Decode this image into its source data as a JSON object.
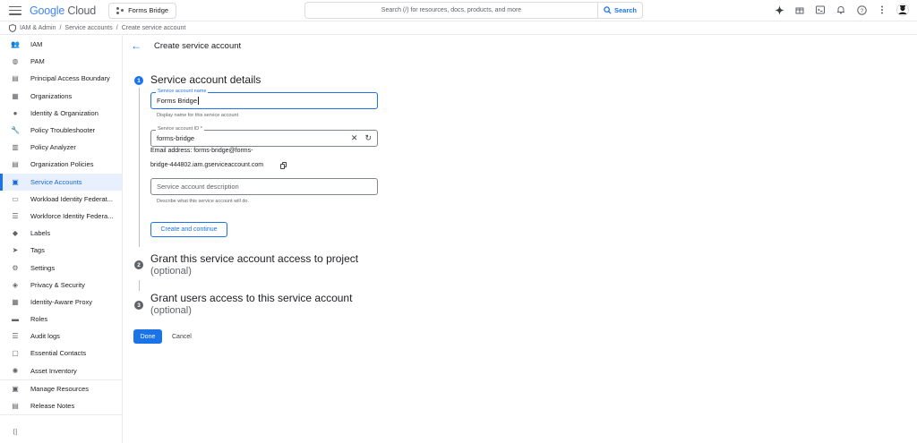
{
  "topbar": {
    "logo": {
      "google": "Google",
      "cloud": "Cloud"
    },
    "project": "Forms Bridge",
    "search_placeholder": "Search (/) for resources, docs, products, and more",
    "search_button": "Search"
  },
  "breadcrumb": [
    "IAM & Admin",
    "Service accounts",
    "Create service account"
  ],
  "sidebar": {
    "items": [
      {
        "label": "IAM",
        "icon": "person-add-icon"
      },
      {
        "label": "PAM",
        "icon": "shield-clock-icon"
      },
      {
        "label": "Principal Access Boundary",
        "icon": "policy-document-icon"
      },
      {
        "label": "Organizations",
        "icon": "building-icon"
      },
      {
        "label": "Identity & Organization",
        "icon": "account-circle-icon"
      },
      {
        "label": "Policy Troubleshooter",
        "icon": "wrench-icon"
      },
      {
        "label": "Policy Analyzer",
        "icon": "document-search-icon"
      },
      {
        "label": "Organization Policies",
        "icon": "list-document-icon"
      },
      {
        "label": "Service Accounts",
        "icon": "service-account-icon",
        "active": true
      },
      {
        "label": "Workload Identity Federat...",
        "icon": "id-card-icon"
      },
      {
        "label": "Workforce Identity Federa...",
        "icon": "list-icon"
      },
      {
        "label": "Labels",
        "icon": "label-icon"
      },
      {
        "label": "Tags",
        "icon": "tag-arrow-icon"
      },
      {
        "label": "Settings",
        "icon": "gear-icon"
      },
      {
        "label": "Privacy & Security",
        "icon": "shield-icon"
      },
      {
        "label": "Identity-Aware Proxy",
        "icon": "proxy-icon"
      },
      {
        "label": "Roles",
        "icon": "roles-icon"
      },
      {
        "label": "Audit logs",
        "icon": "audit-list-icon"
      },
      {
        "label": "Essential Contacts",
        "icon": "contact-card-icon"
      },
      {
        "label": "Asset Inventory",
        "icon": "asset-icon"
      }
    ],
    "footer_items": [
      {
        "label": "Manage Resources",
        "icon": "folder-gear-icon"
      },
      {
        "label": "Release Notes",
        "icon": "release-notes-icon"
      }
    ]
  },
  "page": {
    "title": "Create service account",
    "steps": [
      {
        "number": "1",
        "title": "Service account details"
      },
      {
        "number": "2",
        "title": "Grant this service account access to project",
        "subtitle": "(optional)"
      },
      {
        "number": "3",
        "title": "Grant users access to this service account",
        "subtitle": "(optional)"
      }
    ],
    "form": {
      "name_label": "Service account name",
      "name_value": "Forms Bridge",
      "name_hint": "Display name for this service account",
      "id_label": "Service account ID *",
      "id_value": "forms-bridge",
      "email_line1": "Email address: forms-bridge@forms-",
      "email_line2": "bridge-444802.iam.gserviceaccount.com",
      "description_placeholder": "Service account description",
      "description_hint": "Describe what this service account will do.",
      "create_button": "Create and continue"
    },
    "done_button": "Done",
    "cancel_button": "Cancel"
  },
  "colors": {
    "accent": "#1a73e8",
    "active_bg": "#e8f0fe"
  }
}
